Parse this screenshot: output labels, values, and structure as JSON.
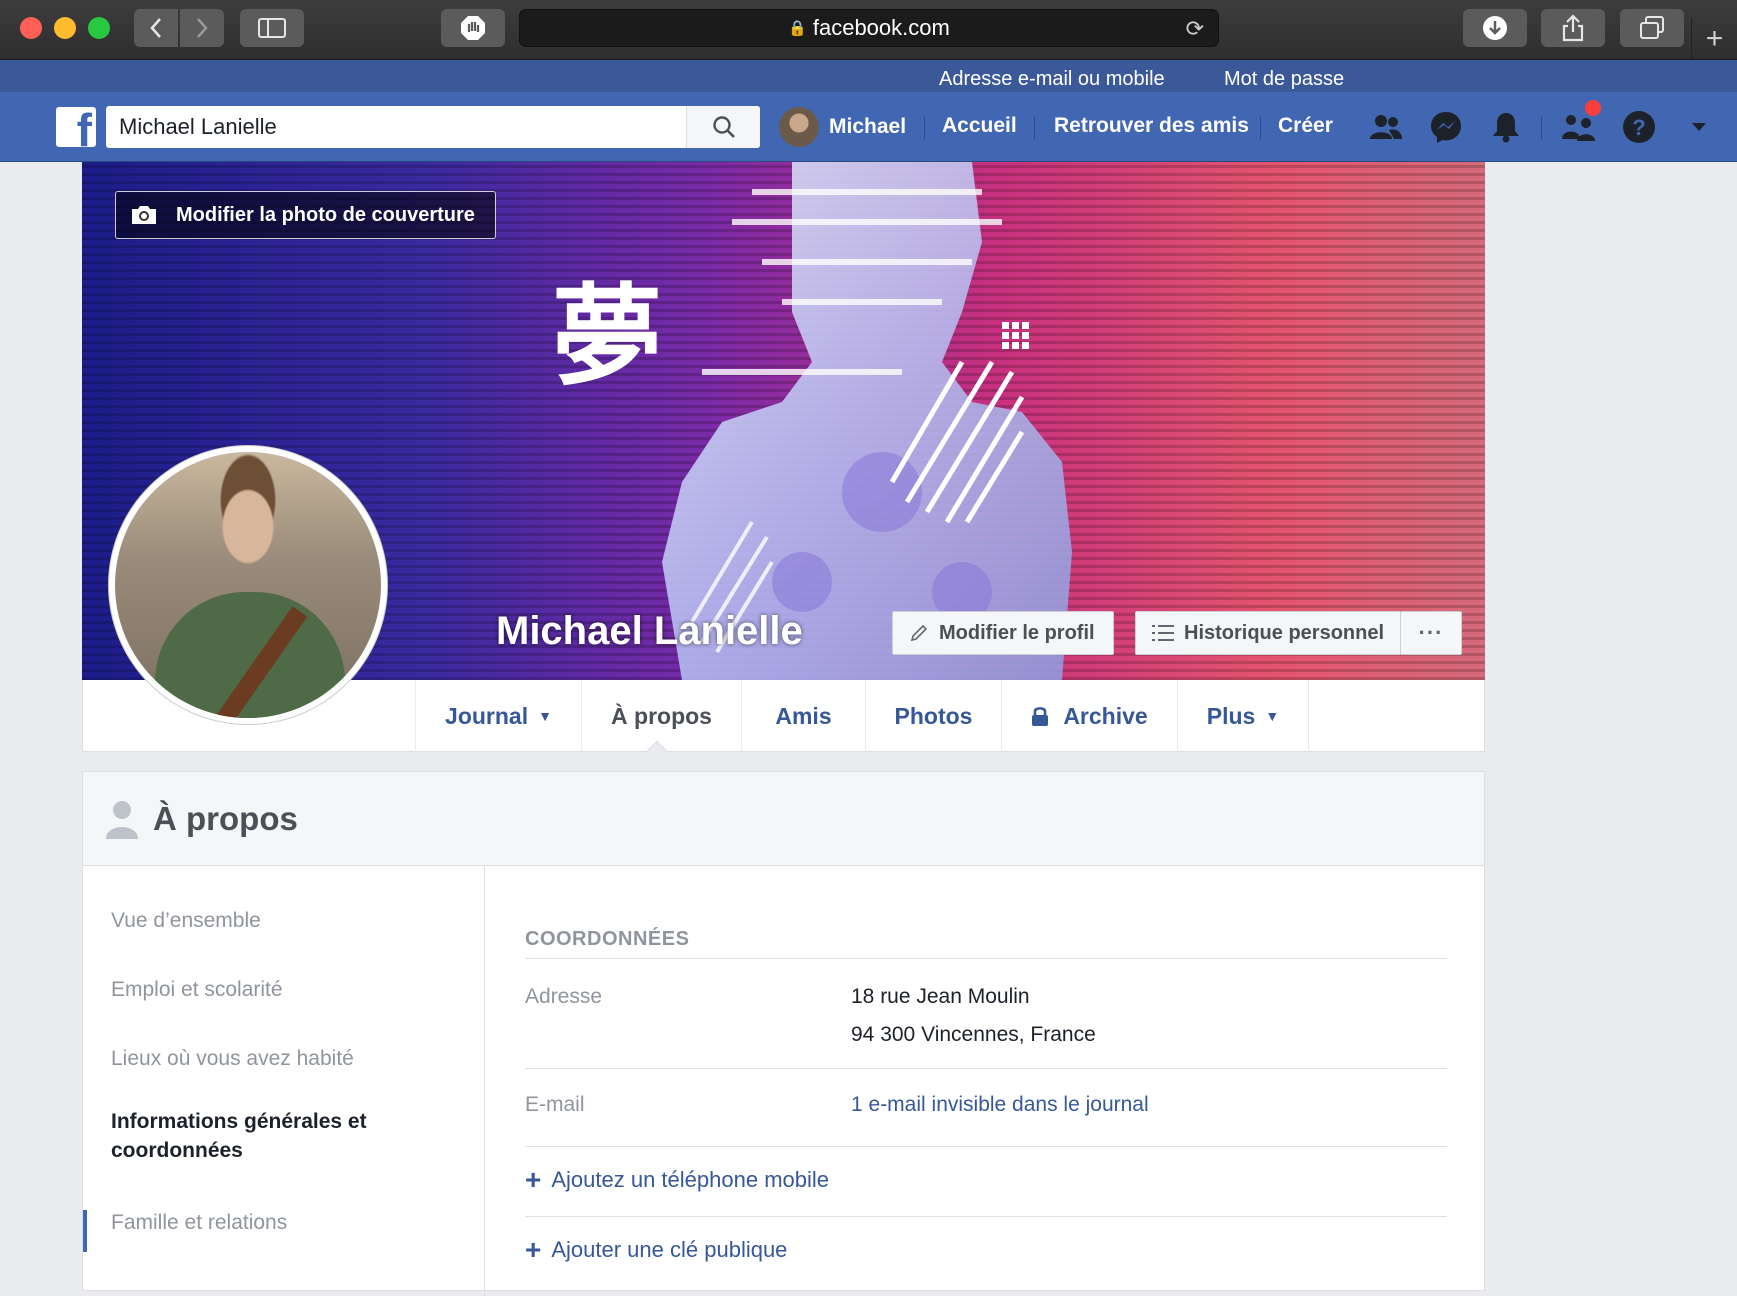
{
  "browser": {
    "url": "facebook.com"
  },
  "login_strip": {
    "email_label": "Adresse e-mail ou mobile",
    "password_label": "Mot de passe"
  },
  "top_nav": {
    "search_value": "Michael Lanielle",
    "user_name": "Michael",
    "links": [
      "Accueil",
      "Retrouver des amis",
      "Créer"
    ]
  },
  "cover": {
    "edit_cover_label": "Modifier la photo de couverture",
    "kanji": "夢",
    "profile_name": "Michael Lanielle",
    "edit_profile_label": "Modifier le profil",
    "activity_log_label": "Historique personnel",
    "more_label": "···"
  },
  "profile_tabs": [
    "Journal",
    "À propos",
    "Amis",
    "Photos",
    "Archive",
    "Plus"
  ],
  "about": {
    "title": "À propos",
    "sidebar": [
      "Vue d’ensemble",
      "Emploi et scolarité",
      "Lieux où vous avez habité",
      "Informations générales et coordonnées",
      "Famille et relations"
    ],
    "section_title": "COORDONNÉES",
    "address_label": "Adresse",
    "address_line1": "18 rue Jean Moulin",
    "address_line2": "94 300 Vincennes, France",
    "email_label": "E-mail",
    "email_value": "1 e-mail invisible dans le journal",
    "add_phone": "Ajoutez un téléphone mobile",
    "add_key": "Ajouter une clé publique"
  },
  "colors": {
    "fb_blue": "#4267b2",
    "fb_dark_blue": "#3b5998",
    "link_blue": "#365899",
    "notification_red": "#fa3e3e"
  }
}
